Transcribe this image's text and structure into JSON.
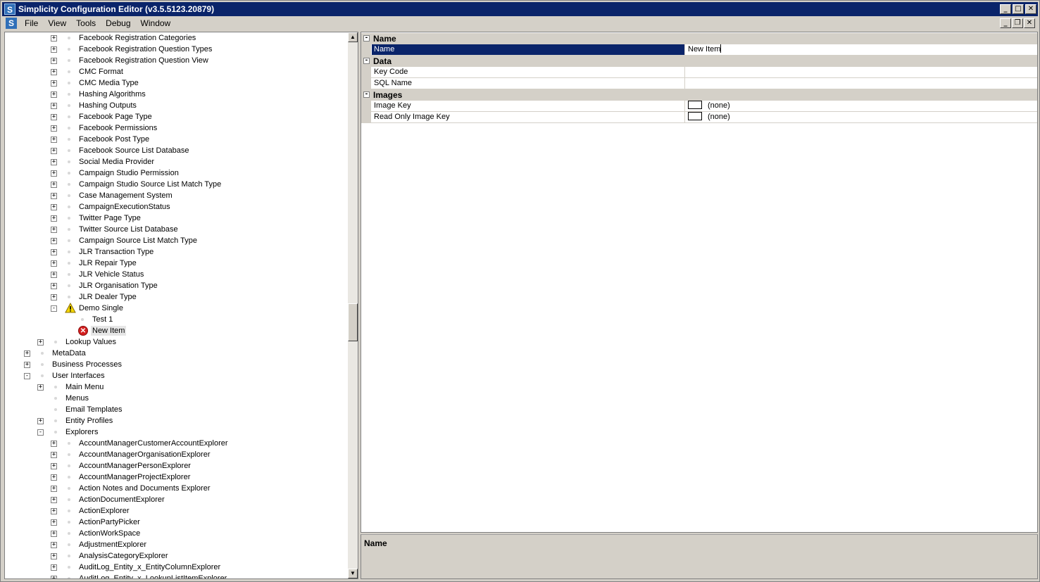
{
  "window": {
    "title": "Simplicity Configuration Editor (v3.5.5123.20879)",
    "app_icon_letter": "S",
    "controls": {
      "minimize": "_",
      "maximize": "□",
      "close": "✕"
    }
  },
  "menu": {
    "items": [
      "File",
      "View",
      "Tools",
      "Debug",
      "Window"
    ],
    "mdi_controls": {
      "minimize": "_",
      "restore": "❐",
      "close": "✕"
    }
  },
  "tree": {
    "rows": [
      {
        "label": "Facebook Registration Categories",
        "level": 3,
        "expander": "+"
      },
      {
        "label": "Facebook Registration Question Types",
        "level": 3,
        "expander": "+"
      },
      {
        "label": "Facebook Registration Question View",
        "level": 3,
        "expander": "+"
      },
      {
        "label": "CMC Format",
        "level": 3,
        "expander": "+"
      },
      {
        "label": "CMC Media Type",
        "level": 3,
        "expander": "+"
      },
      {
        "label": "Hashing Algorithms",
        "level": 3,
        "expander": "+"
      },
      {
        "label": "Hashing Outputs",
        "level": 3,
        "expander": "+"
      },
      {
        "label": "Facebook Page Type",
        "level": 3,
        "expander": "+"
      },
      {
        "label": "Facebook Permissions",
        "level": 3,
        "expander": "+"
      },
      {
        "label": "Facebook Post Type",
        "level": 3,
        "expander": "+"
      },
      {
        "label": "Facebook Source List Database",
        "level": 3,
        "expander": "+"
      },
      {
        "label": "Social Media Provider",
        "level": 3,
        "expander": "+"
      },
      {
        "label": "Campaign Studio Permission",
        "level": 3,
        "expander": "+"
      },
      {
        "label": "Campaign Studio Source List Match Type",
        "level": 3,
        "expander": "+"
      },
      {
        "label": "Case Management System",
        "level": 3,
        "expander": "+"
      },
      {
        "label": "CampaignExecutionStatus",
        "level": 3,
        "expander": "+"
      },
      {
        "label": "Twitter Page Type",
        "level": 3,
        "expander": "+"
      },
      {
        "label": "Twitter Source List Database",
        "level": 3,
        "expander": "+"
      },
      {
        "label": "Campaign Source List Match Type",
        "level": 3,
        "expander": "+"
      },
      {
        "label": "JLR Transaction Type",
        "level": 3,
        "expander": "+"
      },
      {
        "label": "JLR Repair Type",
        "level": 3,
        "expander": "+"
      },
      {
        "label": "JLR Vehicle Status",
        "level": 3,
        "expander": "+"
      },
      {
        "label": "JLR Organisation Type",
        "level": 3,
        "expander": "+"
      },
      {
        "label": "JLR Dealer Type",
        "level": 3,
        "expander": "+"
      },
      {
        "label": "Demo Single",
        "level": 3,
        "expander": "-",
        "icon": "warning-icon"
      },
      {
        "label": "Test 1",
        "level": 4,
        "expander": ""
      },
      {
        "label": "New Item",
        "level": 4,
        "expander": "",
        "icon": "error-icon",
        "selected": true
      },
      {
        "label": "Lookup Values",
        "level": 2,
        "expander": "+"
      },
      {
        "label": "MetaData",
        "level": 1,
        "expander": "+"
      },
      {
        "label": "Business Processes",
        "level": 1,
        "expander": "+"
      },
      {
        "label": "User Interfaces",
        "level": 1,
        "expander": "-"
      },
      {
        "label": "Main Menu",
        "level": 2,
        "expander": "+"
      },
      {
        "label": "Menus",
        "level": 2,
        "expander": ""
      },
      {
        "label": "Email Templates",
        "level": 2,
        "expander": ""
      },
      {
        "label": "Entity Profiles",
        "level": 2,
        "expander": "+"
      },
      {
        "label": "Explorers",
        "level": 2,
        "expander": "-"
      },
      {
        "label": "AccountManagerCustomerAccountExplorer",
        "level": 3,
        "expander": "+"
      },
      {
        "label": "AccountManagerOrganisationExplorer",
        "level": 3,
        "expander": "+"
      },
      {
        "label": "AccountManagerPersonExplorer",
        "level": 3,
        "expander": "+"
      },
      {
        "label": "AccountManagerProjectExplorer",
        "level": 3,
        "expander": "+"
      },
      {
        "label": "Action Notes and Documents Explorer",
        "level": 3,
        "expander": "+"
      },
      {
        "label": "ActionDocumentExplorer",
        "level": 3,
        "expander": "+"
      },
      {
        "label": "ActionExplorer",
        "level": 3,
        "expander": "+"
      },
      {
        "label": "ActionPartyPicker",
        "level": 3,
        "expander": "+"
      },
      {
        "label": "ActionWorkSpace",
        "level": 3,
        "expander": "+"
      },
      {
        "label": "AdjustmentExplorer",
        "level": 3,
        "expander": "+"
      },
      {
        "label": "AnalysisCategoryExplorer",
        "level": 3,
        "expander": "+"
      },
      {
        "label": "AuditLog_Entity_x_EntityColumnExplorer",
        "level": 3,
        "expander": "+"
      },
      {
        "label": "AuditLog_Entity_x_LookupListItemExplorer",
        "level": 3,
        "expander": "+"
      }
    ]
  },
  "property_grid": {
    "categories": [
      {
        "name": "Name",
        "properties": [
          {
            "name": "Name",
            "value": "New Item",
            "selected": true,
            "editing": true
          }
        ]
      },
      {
        "name": "Data",
        "properties": [
          {
            "name": "Key Code",
            "value": ""
          },
          {
            "name": "SQL Name",
            "value": ""
          }
        ]
      },
      {
        "name": "Images",
        "properties": [
          {
            "name": "Image Key",
            "value": "(none)",
            "swatch": true
          },
          {
            "name": "Read Only Image Key",
            "value": "(none)",
            "swatch": true
          }
        ]
      }
    ]
  },
  "description": {
    "title": "Name"
  },
  "scrollbar": {
    "up": "▲",
    "down": "▼"
  }
}
